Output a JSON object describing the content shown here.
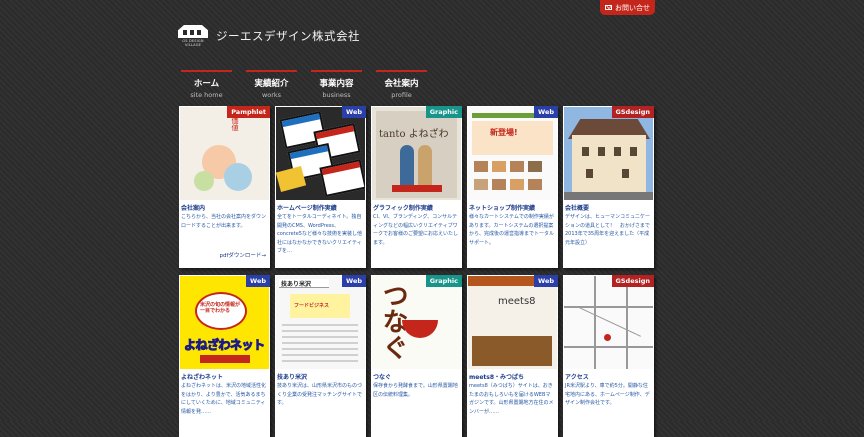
{
  "header": {
    "contact_label": "お問い合せ",
    "logo_caption": "GS DESIGN VILLAGE",
    "company_name": "ジーエスデザイン株式会社"
  },
  "nav": [
    {
      "jp": "ホーム",
      "en": "site home"
    },
    {
      "jp": "実績紹介",
      "en": "works"
    },
    {
      "jp": "事業内容",
      "en": "business"
    },
    {
      "jp": "会社案内",
      "en": "profile"
    }
  ],
  "cards": [
    {
      "badge": "Pamphlet",
      "title": "会社案内",
      "desc": "こちらから、当社の会社案内をダウンロードすることが出来ます。",
      "link": "pdfダウンロード→",
      "thumb_text": "価値"
    },
    {
      "badge": "Web",
      "title": "ホームページ制作実績",
      "desc": "全てをトータルコーディネイト。独自開発のCMS、WordPress、concrete5など様々な技術を実装し他社にはなかなかできないクリエイティブを…",
      "link": ""
    },
    {
      "badge": "Graphic",
      "title": "グラフィック制作実績",
      "desc": "CI、VI、ブランディング、コンサルティングなどの幅広いクリエイティブワークでお客様のご要望にお応えいたします。",
      "link": "",
      "thumb_text": "tanto よねざわ"
    },
    {
      "badge": "Web",
      "title": "ネットショップ制作実績",
      "desc": "様々なカートシステムでの制作実績があります。カートシステムの選択提案から、完成後の運営指導までトータルサポート。",
      "link": "",
      "thumb_text": "新登場!"
    },
    {
      "badge": "GSdesign",
      "title": "会社概要",
      "desc": "デザインは、ヒューマンコミュニケーションの道具として！　おかげさまで2013年で35周年を迎えました（平成元年設立）",
      "link": ""
    },
    {
      "badge": "Web",
      "title": "よねざわネット",
      "desc": "よねざわネットは、米沢の地域活性化をはかり、より豊かで、活気あるまちにしていくために、地域コミュニティ情報を発……",
      "link": "",
      "thumb_text": "よねざわネット",
      "thumb_text2": "米沢の旬の情報が一目でわかる"
    },
    {
      "badge": "Web",
      "title": "技あり米沢",
      "desc": "技あり米沢は、山形県米沢市のものづくり企業の受発注マッチングサイトです。",
      "link": "",
      "thumb_text": "技あり米沢",
      "thumb_text2": "フードビジネス"
    },
    {
      "badge": "Graphic",
      "title": "つなぐ",
      "desc": "保存食から発酵食まで。山形県置賜地区の伝統料理集。",
      "link": "",
      "thumb_text": "つなぐ"
    },
    {
      "badge": "Web",
      "title": "meets8・みつばち",
      "desc": "meets8（みつばち）サイトは、おきたまのおもしろいもを届けるWEBマガジンです。山形県置賜地方在住のメンバーが……",
      "link": "",
      "thumb_text": "meets8"
    },
    {
      "badge": "GSdesign",
      "title": "アクセス",
      "desc": "JR米沢駅より、車で約5分。開静な住宅地内にある、ホームページ制作、デザイン制作会社です。",
      "link": ""
    }
  ],
  "colors": {
    "accent": "#c4261b",
    "background": "#2b2b2b",
    "link": "#1a3a8a"
  }
}
